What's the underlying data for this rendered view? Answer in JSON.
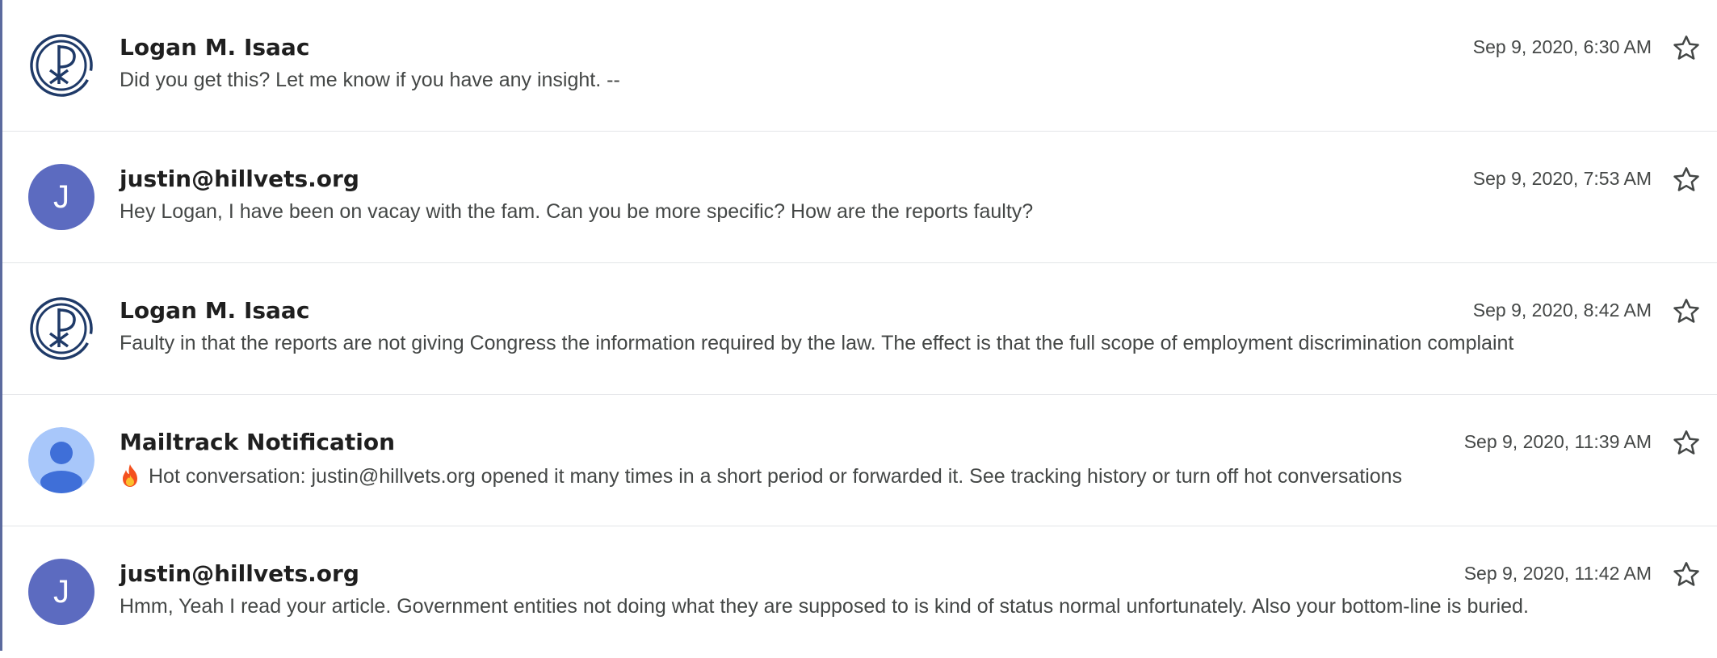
{
  "messages": [
    {
      "sender": "Logan M. Isaac",
      "date": "Sep 9, 2020, 6:30 AM",
      "snippet": "Did you get this? Let me know if you have any insight. --",
      "avatar": "chi-rho-logo-icon"
    },
    {
      "sender": "justin@hillvets.org",
      "date": "Sep 9, 2020, 7:53 AM",
      "snippet": "Hey Logan, I have been on vacay with the fam. Can you be more specific? How are the reports faulty?",
      "avatar": "letter",
      "initial": "J"
    },
    {
      "sender": "Logan M. Isaac",
      "date": "Sep 9, 2020, 8:42 AM",
      "snippet": "Faulty in that the reports are not giving Congress the information required by the law. The effect is that the full scope of employment discrimination complaint",
      "avatar": "chi-rho-logo-icon"
    },
    {
      "sender": "Mailtrack Notification",
      "date": "Sep 9, 2020, 11:39 AM",
      "snippet": "Hot conversation: justin@hillvets.org opened it many times in a short period or forwarded it. See tracking history or turn off hot conversations",
      "avatar": "person-icon",
      "snippet_icon": "fire-icon"
    },
    {
      "sender": "justin@hillvets.org",
      "date": "Sep 9, 2020, 11:42 AM",
      "snippet": "Hmm, Yeah I read your article. Government entities not doing what they are supposed to is kind of status normal unfortunately. Also your bottom-line is buried.",
      "avatar": "letter",
      "initial": "J"
    }
  ],
  "colors": {
    "letter_avatar": "#5c6bc0",
    "logo_navy": "#1f3a68",
    "person_avatar_bg": "#a8c7fa",
    "person_avatar_fg": "#3f6fd8"
  },
  "star_icon": "star-outline-icon"
}
